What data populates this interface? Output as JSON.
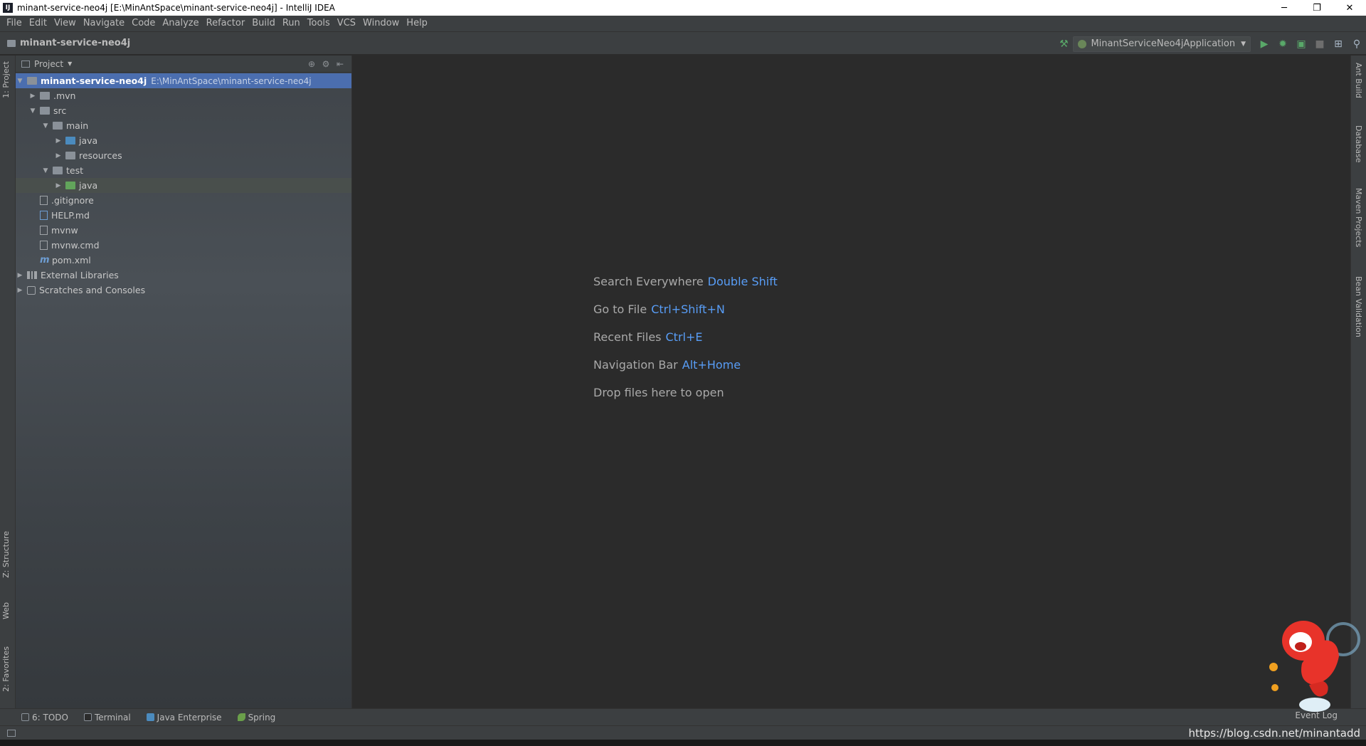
{
  "window": {
    "title": "minant-service-neo4j [E:\\MinAntSpace\\minant-service-neo4j] - IntelliJ IDEA",
    "app_icon_text": "IJ",
    "controls": {
      "minimize": "─",
      "restore": "❐",
      "close": "✕"
    }
  },
  "menu": [
    "File",
    "Edit",
    "View",
    "Navigate",
    "Code",
    "Analyze",
    "Refactor",
    "Build",
    "Run",
    "Tools",
    "VCS",
    "Window",
    "Help"
  ],
  "navbar": {
    "project_name": "minant-service-neo4j",
    "run_config": "MinantServiceNeo4jApplication"
  },
  "left_tabs": {
    "project": "1: Project",
    "structure": "Z: Structure",
    "web": "Web",
    "favorites": "2: Favorites"
  },
  "right_tabs": {
    "ant": "Ant Build",
    "database": "Database",
    "maven": "Maven Projects",
    "bean": "Bean Validation"
  },
  "project_panel": {
    "title": "Project",
    "tree": [
      {
        "label": "minant-service-neo4j",
        "path": "E:\\MinAntSpace\\minant-service-neo4j"
      },
      {
        "label": ".mvn"
      },
      {
        "label": "src"
      },
      {
        "label": "main"
      },
      {
        "label": "java"
      },
      {
        "label": "resources"
      },
      {
        "label": "test"
      },
      {
        "label": "java"
      },
      {
        "label": ".gitignore"
      },
      {
        "label": "HELP.md"
      },
      {
        "label": "mvnw"
      },
      {
        "label": "mvnw.cmd"
      },
      {
        "label": "pom.xml"
      },
      {
        "label": "External Libraries"
      },
      {
        "label": "Scratches and Consoles"
      }
    ]
  },
  "welcome": {
    "search": {
      "label": "Search Everywhere",
      "key": "Double Shift"
    },
    "goto_file": {
      "label": "Go to File",
      "key": "Ctrl+Shift+N"
    },
    "recent": {
      "label": "Recent Files",
      "key": "Ctrl+E"
    },
    "navbar": {
      "label": "Navigation Bar",
      "key": "Alt+Home"
    },
    "drop": "Drop files here to open"
  },
  "bottom_tabs": [
    "6: TODO",
    "Terminal",
    "Java Enterprise",
    "Spring"
  ],
  "event_log": "Event Log",
  "watermark": "https://blog.csdn.net/minantadd",
  "colors": {
    "selection": "#4b6eaf",
    "accent_key": "#589df6",
    "run_green": "#59a869"
  }
}
